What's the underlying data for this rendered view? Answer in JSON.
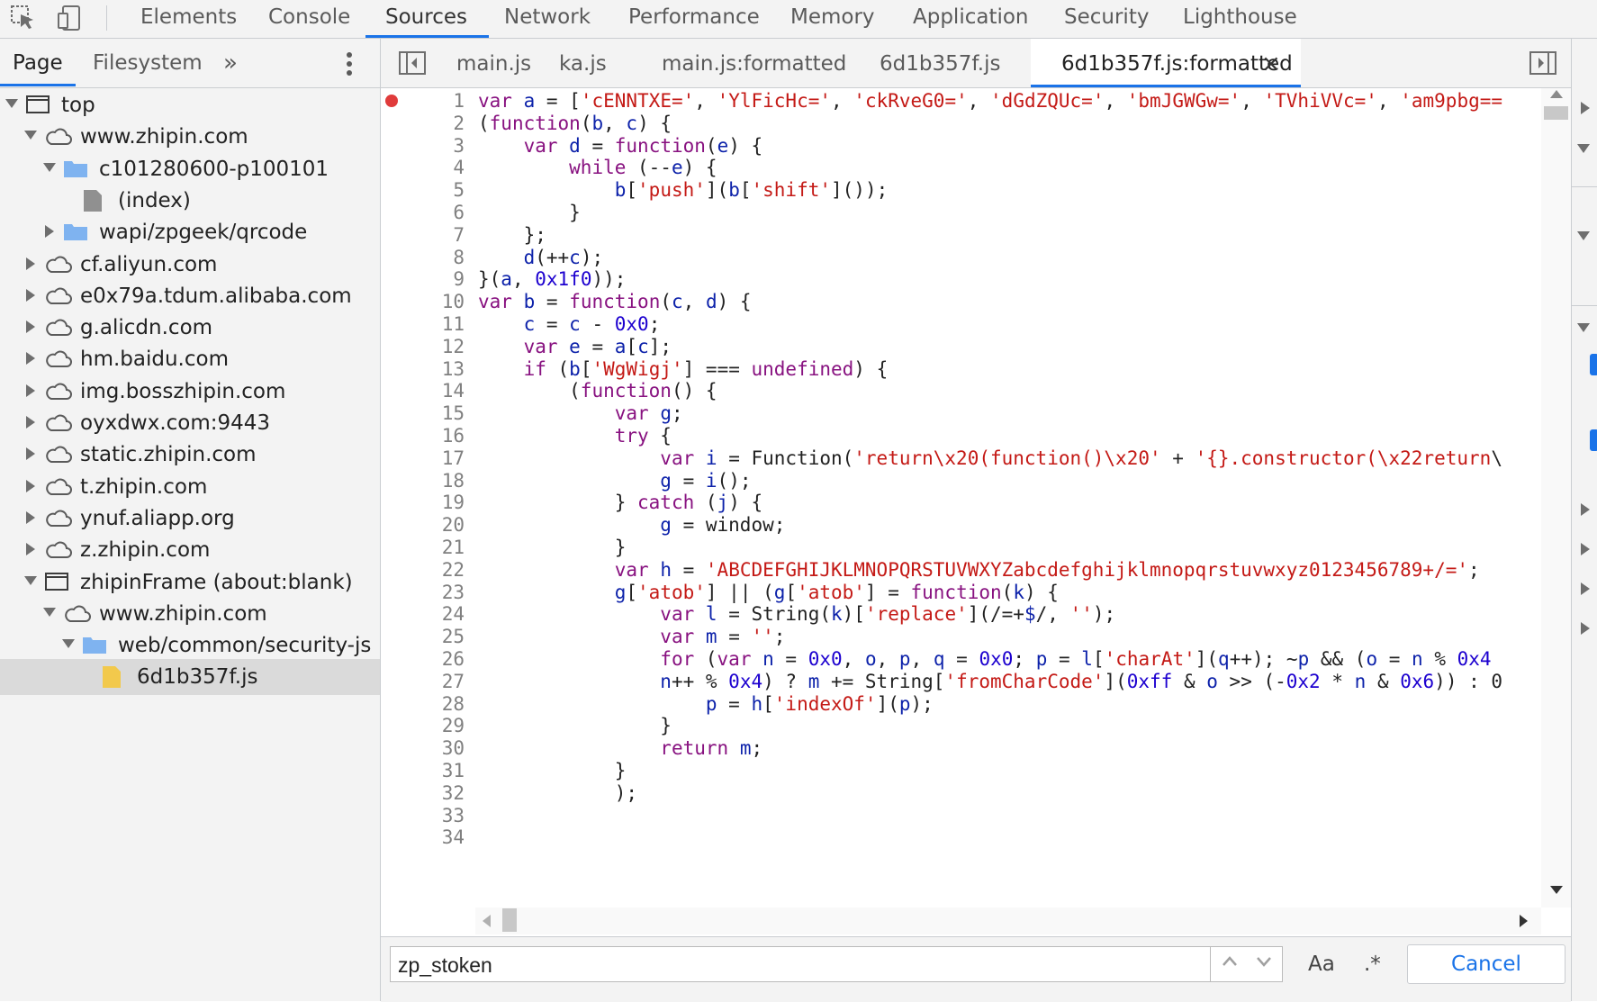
{
  "toolbar": {
    "tabs": [
      "Elements",
      "Console",
      "Sources",
      "Network",
      "Performance",
      "Memory",
      "Application",
      "Security",
      "Lighthouse"
    ],
    "active_tab": "Sources"
  },
  "navigator": {
    "tabs": [
      "Page",
      "Filesystem"
    ],
    "more_label": "»",
    "tree": [
      {
        "label": "top",
        "icon": "frame-icon",
        "expanded": true
      },
      {
        "label": "www.zhipin.com",
        "icon": "cloud-icon",
        "expanded": true
      },
      {
        "label": "c101280600-p100101",
        "icon": "folder-icon",
        "expanded": true
      },
      {
        "label": "(index)",
        "icon": "file-icon"
      },
      {
        "label": "wapi/zpgeek/qrcode",
        "icon": "folder-icon",
        "expanded": false
      },
      {
        "label": "cf.aliyun.com",
        "icon": "cloud-icon",
        "expanded": false
      },
      {
        "label": "e0x79a.tdum.alibaba.com",
        "icon": "cloud-icon",
        "expanded": false
      },
      {
        "label": "g.alicdn.com",
        "icon": "cloud-icon",
        "expanded": false
      },
      {
        "label": "hm.baidu.com",
        "icon": "cloud-icon",
        "expanded": false
      },
      {
        "label": "img.bosszhipin.com",
        "icon": "cloud-icon",
        "expanded": false
      },
      {
        "label": "oyxdwx.com:9443",
        "icon": "cloud-icon",
        "expanded": false
      },
      {
        "label": "static.zhipin.com",
        "icon": "cloud-icon",
        "expanded": false
      },
      {
        "label": "t.zhipin.com",
        "icon": "cloud-icon",
        "expanded": false
      },
      {
        "label": "ynuf.aliapp.org",
        "icon": "cloud-icon",
        "expanded": false
      },
      {
        "label": "z.zhipin.com",
        "icon": "cloud-icon",
        "expanded": false
      },
      {
        "label": "zhipinFrame (about:blank)",
        "icon": "frame-icon",
        "expanded": true
      },
      {
        "label": "www.zhipin.com",
        "icon": "cloud-icon",
        "expanded": true
      },
      {
        "label": "web/common/security-js",
        "icon": "folder-icon",
        "expanded": true
      },
      {
        "label": "6d1b357f.js",
        "icon": "js-file-icon",
        "selected": true
      }
    ]
  },
  "editor": {
    "tabs": [
      "main.js",
      "ka.js",
      "main.js:formatted",
      "6d1b357f.js",
      "6d1b357f.js:formatted"
    ],
    "active_tab": "6d1b357f.js:formatted",
    "close_glyph": "×",
    "breakpoint_line": 1,
    "lines": [
      "var a = ['cENNTXE=', 'YlFicHc=', 'ckRveG0=', 'dGdZQUc=', 'bmJGWGw=', 'TVhiVVc=', 'am9pbg==",
      "(function(b, c) {",
      "    var d = function(e) {",
      "        while (--e) {",
      "            b['push'](b['shift']());",
      "        }",
      "    };",
      "    d(++c);",
      "}(a, 0x1f0));",
      "var b = function(c, d) {",
      "    c = c - 0x0;",
      "    var e = a[c];",
      "    if (b['WgWigj'] === undefined) {",
      "        (function() {",
      "            var g;",
      "            try {",
      "                var i = Function('return\\x20(function()\\x20' + '{}.constructor(\\x22return\\",
      "                g = i();",
      "            } catch (j) {",
      "                g = window;",
      "            }",
      "            var h = 'ABCDEFGHIJKLMNOPQRSTUVWXYZabcdefghijklmnopqrstuvwxyz0123456789+/=';",
      "            g['atob'] || (g['atob'] = function(k) {",
      "                var l = String(k)['replace'](/=+$/, '');",
      "                var m = '';",
      "                for (var n = 0x0, o, p, q = 0x0; p = l['charAt'](q++); ~p && (o = n % 0x4",
      "                n++ % 0x4) ? m += String['fromCharCode'](0xff & o >> (-0x2 * n & 0x6)) : 0",
      "                    p = h['indexOf'](p);",
      "                }",
      "                return m;",
      "            }",
      "            );",
      "",
      ""
    ]
  },
  "search": {
    "query": "zp_stoken",
    "match_case_label": "Aa",
    "regex_label": ".*",
    "cancel_label": "Cancel"
  }
}
